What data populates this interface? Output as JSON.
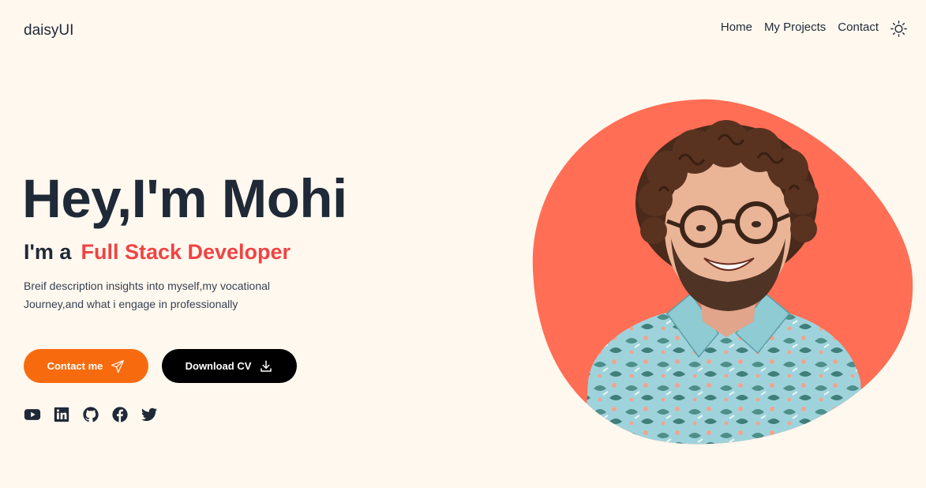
{
  "navbar": {
    "brand": "daisyUI",
    "links": [
      "Home",
      "My Projects",
      "Contact"
    ],
    "theme_icon": "sun-icon"
  },
  "hero": {
    "title": "Hey,I'm Mohi",
    "subtitle_prefix": "I'm a",
    "subtitle_role": "Full Stack Developer",
    "description": "Breif description insights into myself,my vocational Journey,and what i engage in professionally",
    "contact_button": "Contact me",
    "contact_icon": "send-icon",
    "cv_button": "Download CV",
    "cv_icon": "download-icon",
    "socials": [
      "youtube-icon",
      "linkedin-icon",
      "github-icon",
      "facebook-icon",
      "twitter-icon"
    ],
    "portrait": "smiling man with curly hair, glasses and floral shirt"
  },
  "colors": {
    "background": "#fff8ef",
    "text": "#1f2937",
    "accent_red": "#ef4444",
    "button_orange": "#f76b0e",
    "button_black": "#000000",
    "blob": "#ff6e55"
  }
}
